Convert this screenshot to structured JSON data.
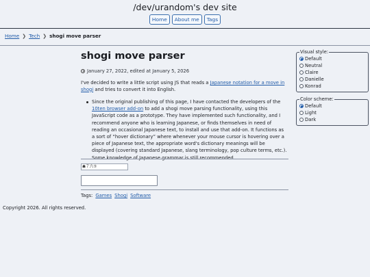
{
  "site": {
    "title": "/dev/urandom's dev site",
    "nav": [
      "Home",
      "About me",
      "Tags"
    ]
  },
  "breadcrumb": {
    "items": [
      "Home",
      "Tech"
    ],
    "current": "shogi move parser"
  },
  "article": {
    "title": "shogi move parser",
    "meta": "January 27, 2022, edited at January 5, 2026",
    "intro_pre": "I've decided to write a little script using JS that reads a ",
    "intro_link": "Japanese notation for a move in shogi",
    "intro_post": " and tries to convert it into English.",
    "bullet_pre": "Since the original publishing of this page, I have contacted the developers of the ",
    "bullet_link": "10ten browser add-on",
    "bullet_post": " to add a shogi move parsing functionality, using this JavaScript code as a prototype. They have implemented such functionality, and I recommend anyone who is learning Japanese, or finds themselves in need of reading an occasional Japanese text, to install and use that add-on. It functions as a sort of “hover dictionary” where whenever your mouse cursor is hovering over a piece of Japanese text, the appropriate word's dictionary meanings will be displayed (covering standard Japanese, slang terminology, pop culture terms, etc.). Some knowledge of Japanese grammar is still recommended.",
    "input_value": "☗７六⑤",
    "textarea_value": ""
  },
  "tags": {
    "label": "Tags:",
    "items": [
      "Games",
      "Shogi",
      "Software"
    ]
  },
  "footer": {
    "copyright": "Copyright 2026. All rights reserved."
  },
  "visual_style": {
    "legend": "Visual style:",
    "options": [
      "Default",
      "Neutral",
      "Claire",
      "Danielle",
      "Konrad"
    ],
    "selected": "Default"
  },
  "color_scheme": {
    "legend": "Color scheme:",
    "options": [
      "Default",
      "Light",
      "Dark"
    ],
    "selected": "Default"
  },
  "colors": {
    "background": "#eef1f6",
    "link": "#1f5aa8",
    "text": "#1b1d22"
  }
}
